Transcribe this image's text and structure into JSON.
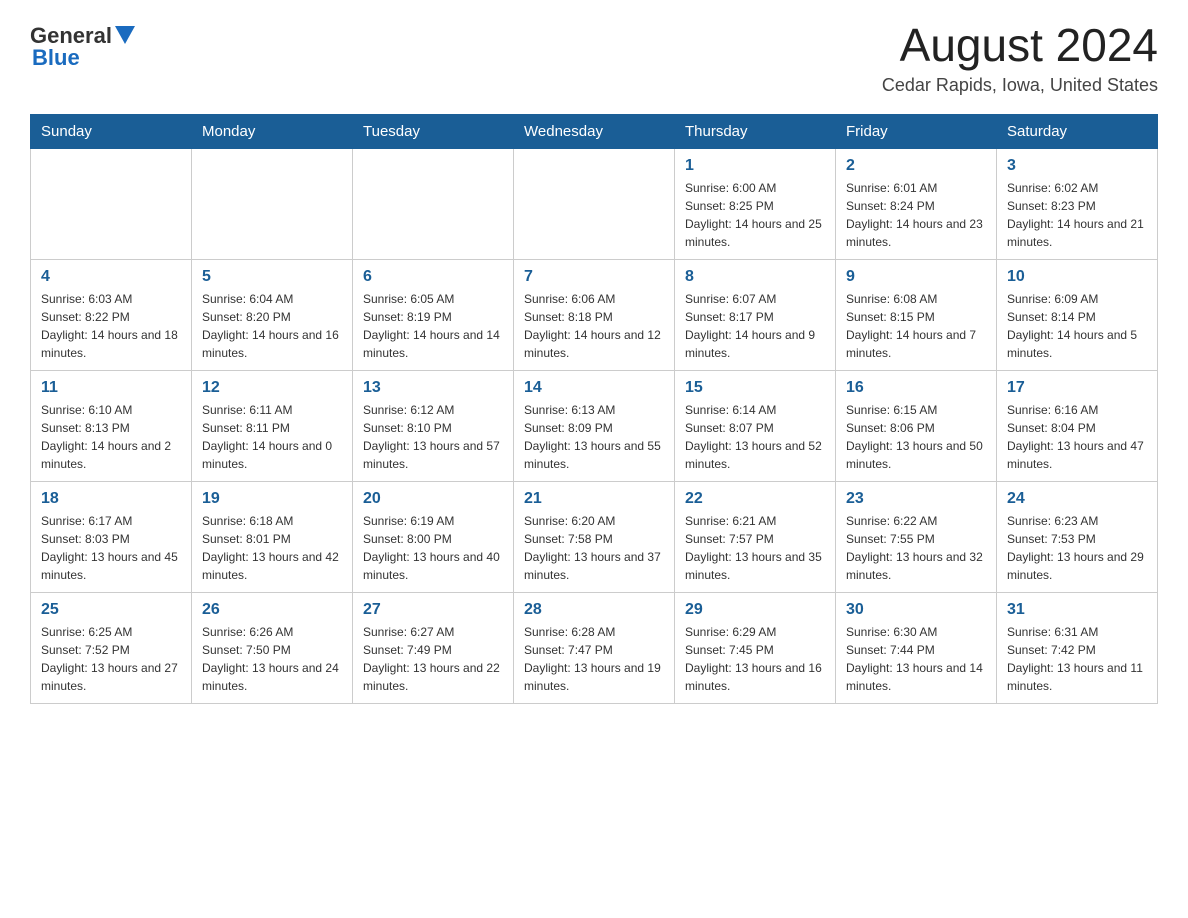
{
  "header": {
    "logo_general": "General",
    "logo_blue": "Blue",
    "month_title": "August 2024",
    "location": "Cedar Rapids, Iowa, United States"
  },
  "weekdays": [
    "Sunday",
    "Monday",
    "Tuesday",
    "Wednesday",
    "Thursday",
    "Friday",
    "Saturday"
  ],
  "weeks": [
    [
      {
        "day": "",
        "info": ""
      },
      {
        "day": "",
        "info": ""
      },
      {
        "day": "",
        "info": ""
      },
      {
        "day": "",
        "info": ""
      },
      {
        "day": "1",
        "info": "Sunrise: 6:00 AM\nSunset: 8:25 PM\nDaylight: 14 hours and 25 minutes."
      },
      {
        "day": "2",
        "info": "Sunrise: 6:01 AM\nSunset: 8:24 PM\nDaylight: 14 hours and 23 minutes."
      },
      {
        "day": "3",
        "info": "Sunrise: 6:02 AM\nSunset: 8:23 PM\nDaylight: 14 hours and 21 minutes."
      }
    ],
    [
      {
        "day": "4",
        "info": "Sunrise: 6:03 AM\nSunset: 8:22 PM\nDaylight: 14 hours and 18 minutes."
      },
      {
        "day": "5",
        "info": "Sunrise: 6:04 AM\nSunset: 8:20 PM\nDaylight: 14 hours and 16 minutes."
      },
      {
        "day": "6",
        "info": "Sunrise: 6:05 AM\nSunset: 8:19 PM\nDaylight: 14 hours and 14 minutes."
      },
      {
        "day": "7",
        "info": "Sunrise: 6:06 AM\nSunset: 8:18 PM\nDaylight: 14 hours and 12 minutes."
      },
      {
        "day": "8",
        "info": "Sunrise: 6:07 AM\nSunset: 8:17 PM\nDaylight: 14 hours and 9 minutes."
      },
      {
        "day": "9",
        "info": "Sunrise: 6:08 AM\nSunset: 8:15 PM\nDaylight: 14 hours and 7 minutes."
      },
      {
        "day": "10",
        "info": "Sunrise: 6:09 AM\nSunset: 8:14 PM\nDaylight: 14 hours and 5 minutes."
      }
    ],
    [
      {
        "day": "11",
        "info": "Sunrise: 6:10 AM\nSunset: 8:13 PM\nDaylight: 14 hours and 2 minutes."
      },
      {
        "day": "12",
        "info": "Sunrise: 6:11 AM\nSunset: 8:11 PM\nDaylight: 14 hours and 0 minutes."
      },
      {
        "day": "13",
        "info": "Sunrise: 6:12 AM\nSunset: 8:10 PM\nDaylight: 13 hours and 57 minutes."
      },
      {
        "day": "14",
        "info": "Sunrise: 6:13 AM\nSunset: 8:09 PM\nDaylight: 13 hours and 55 minutes."
      },
      {
        "day": "15",
        "info": "Sunrise: 6:14 AM\nSunset: 8:07 PM\nDaylight: 13 hours and 52 minutes."
      },
      {
        "day": "16",
        "info": "Sunrise: 6:15 AM\nSunset: 8:06 PM\nDaylight: 13 hours and 50 minutes."
      },
      {
        "day": "17",
        "info": "Sunrise: 6:16 AM\nSunset: 8:04 PM\nDaylight: 13 hours and 47 minutes."
      }
    ],
    [
      {
        "day": "18",
        "info": "Sunrise: 6:17 AM\nSunset: 8:03 PM\nDaylight: 13 hours and 45 minutes."
      },
      {
        "day": "19",
        "info": "Sunrise: 6:18 AM\nSunset: 8:01 PM\nDaylight: 13 hours and 42 minutes."
      },
      {
        "day": "20",
        "info": "Sunrise: 6:19 AM\nSunset: 8:00 PM\nDaylight: 13 hours and 40 minutes."
      },
      {
        "day": "21",
        "info": "Sunrise: 6:20 AM\nSunset: 7:58 PM\nDaylight: 13 hours and 37 minutes."
      },
      {
        "day": "22",
        "info": "Sunrise: 6:21 AM\nSunset: 7:57 PM\nDaylight: 13 hours and 35 minutes."
      },
      {
        "day": "23",
        "info": "Sunrise: 6:22 AM\nSunset: 7:55 PM\nDaylight: 13 hours and 32 minutes."
      },
      {
        "day": "24",
        "info": "Sunrise: 6:23 AM\nSunset: 7:53 PM\nDaylight: 13 hours and 29 minutes."
      }
    ],
    [
      {
        "day": "25",
        "info": "Sunrise: 6:25 AM\nSunset: 7:52 PM\nDaylight: 13 hours and 27 minutes."
      },
      {
        "day": "26",
        "info": "Sunrise: 6:26 AM\nSunset: 7:50 PM\nDaylight: 13 hours and 24 minutes."
      },
      {
        "day": "27",
        "info": "Sunrise: 6:27 AM\nSunset: 7:49 PM\nDaylight: 13 hours and 22 minutes."
      },
      {
        "day": "28",
        "info": "Sunrise: 6:28 AM\nSunset: 7:47 PM\nDaylight: 13 hours and 19 minutes."
      },
      {
        "day": "29",
        "info": "Sunrise: 6:29 AM\nSunset: 7:45 PM\nDaylight: 13 hours and 16 minutes."
      },
      {
        "day": "30",
        "info": "Sunrise: 6:30 AM\nSunset: 7:44 PM\nDaylight: 13 hours and 14 minutes."
      },
      {
        "day": "31",
        "info": "Sunrise: 6:31 AM\nSunset: 7:42 PM\nDaylight: 13 hours and 11 minutes."
      }
    ]
  ]
}
